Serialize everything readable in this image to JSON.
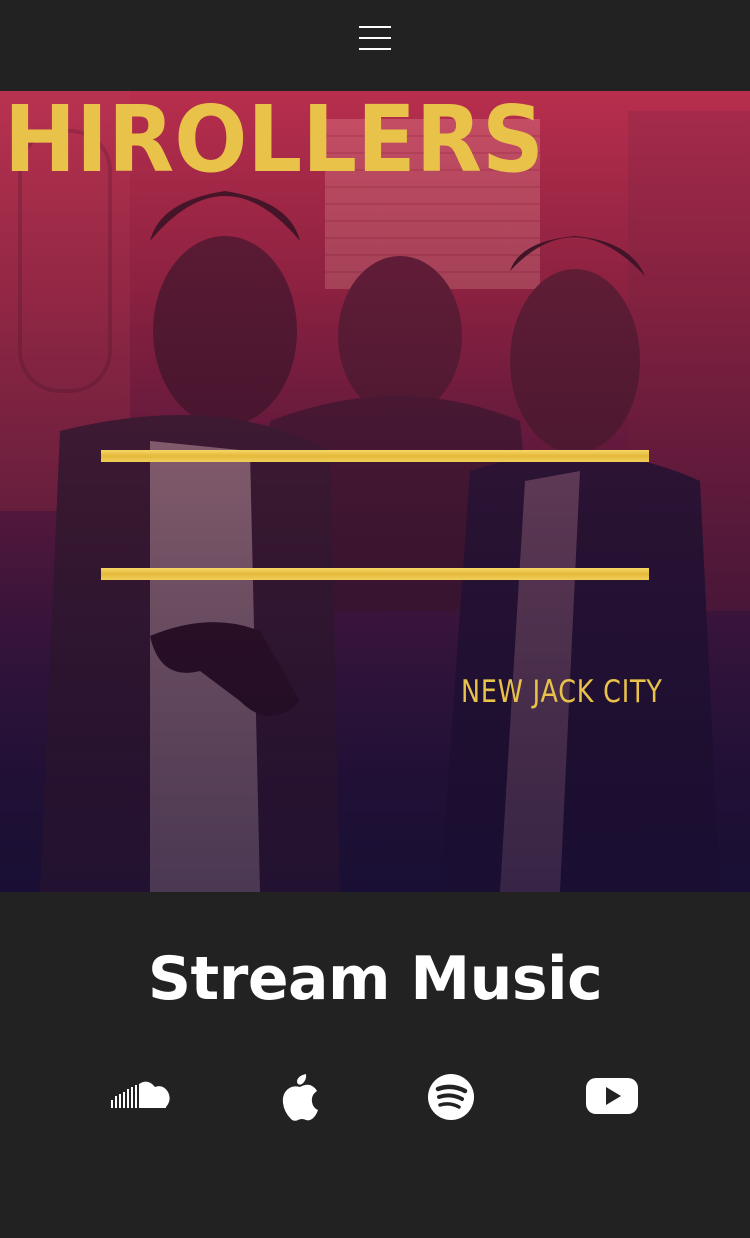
{
  "header": {
    "menu_icon": "hamburger-menu-icon"
  },
  "hero": {
    "logo_text": "HIROLLERS",
    "logo_subtitle": "NEW JACK CITY",
    "logo_color": "#e9c24a",
    "tint_colors": [
      "#b42a4a",
      "#7a1c4a",
      "#1f1440"
    ]
  },
  "stream": {
    "title": "Stream Music",
    "links": [
      {
        "icon": "soundcloud-icon"
      },
      {
        "icon": "apple-icon"
      },
      {
        "icon": "spotify-icon"
      },
      {
        "icon": "youtube-icon"
      }
    ]
  },
  "colors": {
    "background": "#222222",
    "text": "#ffffff"
  }
}
